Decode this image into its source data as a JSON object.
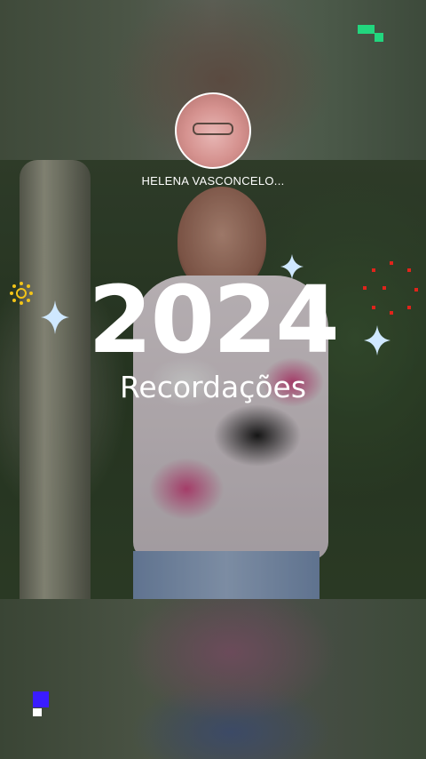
{
  "profile": {
    "name": "HELENA VASCONCELO..."
  },
  "headline": {
    "year": "2024",
    "subtitle": "Recordações"
  },
  "colors": {
    "text": "#ffffff",
    "sparkle": "#cfe8ff",
    "sun": "#f2c418",
    "dots": "#e0241b",
    "corner_top_right": "#22d67e",
    "corner_bottom_left": "#3a1cff"
  },
  "icons": {
    "sparkles": [
      "sparkle-icon",
      "sparkle-icon",
      "sparkle-icon"
    ],
    "sun": "sun-icon",
    "dots": "dotted-burst-icon",
    "corner_top_right": "pixel-mark-icon",
    "corner_bottom_left": "pixel-mark-icon"
  }
}
